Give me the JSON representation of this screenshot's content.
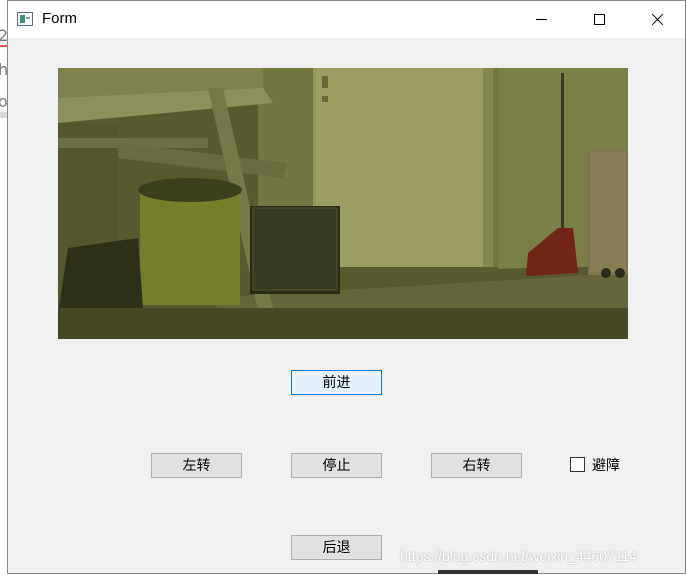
{
  "window": {
    "title": "Form",
    "controls": {
      "minimize": "minimize-icon",
      "maximize": "maximize-icon",
      "close": "close-icon"
    }
  },
  "video": {
    "description_icon": "camera-feed"
  },
  "controls": {
    "forward_label": "前进",
    "left_label": "左转",
    "stop_label": "停止",
    "right_label": "右转",
    "back_label": "后退",
    "avoid_label": "避障",
    "avoid_checked": false
  },
  "watermark": "https://blog.csdn.net/weixin_44607114",
  "colors": {
    "window_bg": "#f0f0f0",
    "titlebar_bg": "#ffffff",
    "button_bg": "#e1e1e1",
    "focus_border": "#0078d7",
    "video_tint": "#4a4d2a"
  }
}
